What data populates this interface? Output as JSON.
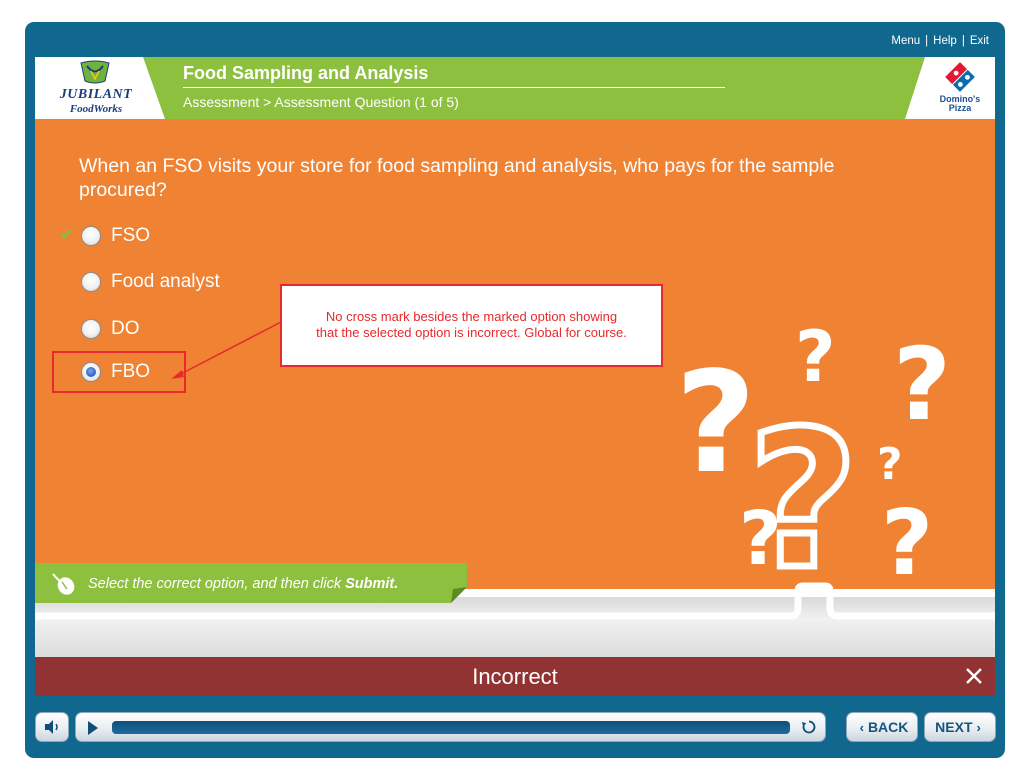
{
  "top_menu": {
    "menu": "Menu",
    "help": "Help",
    "exit": "Exit",
    "separator": "|"
  },
  "header": {
    "course_title": "Food Sampling and Analysis",
    "breadcrumb": "Assessment > Assessment Question (1 of 5)",
    "logo_left": {
      "line1": "JUBILANT",
      "line2": "FoodWorks"
    },
    "logo_right": {
      "line1": "Domino's",
      "line2": "Pizza"
    }
  },
  "question": {
    "text": "When an FSO visits your store for food sampling and analysis, who pays for the sample procured?",
    "options": [
      {
        "label": "FSO",
        "selected": false,
        "correct": true
      },
      {
        "label": "Food analyst",
        "selected": false
      },
      {
        "label": "DO",
        "selected": false
      },
      {
        "label": "FBO",
        "selected": true
      }
    ],
    "correct_mark": "✔"
  },
  "annotation": {
    "line1": "No cross mark besides the marked option showing",
    "line2": "that the selected option is incorrect. Global for course."
  },
  "instruction": {
    "prefix": "Select the correct option, and then click ",
    "action": "Submit."
  },
  "feedback": {
    "text": "Incorrect",
    "close_icon": "close-icon"
  },
  "controls": {
    "back": "BACK",
    "next": "NEXT",
    "chev_left": "‹",
    "chev_right": "›"
  },
  "colors": {
    "frame": "#11688f",
    "orange": "#ef8233",
    "green": "#8dc03f",
    "feedback_bar": "#923333",
    "annotation_red": "#e8292d"
  }
}
